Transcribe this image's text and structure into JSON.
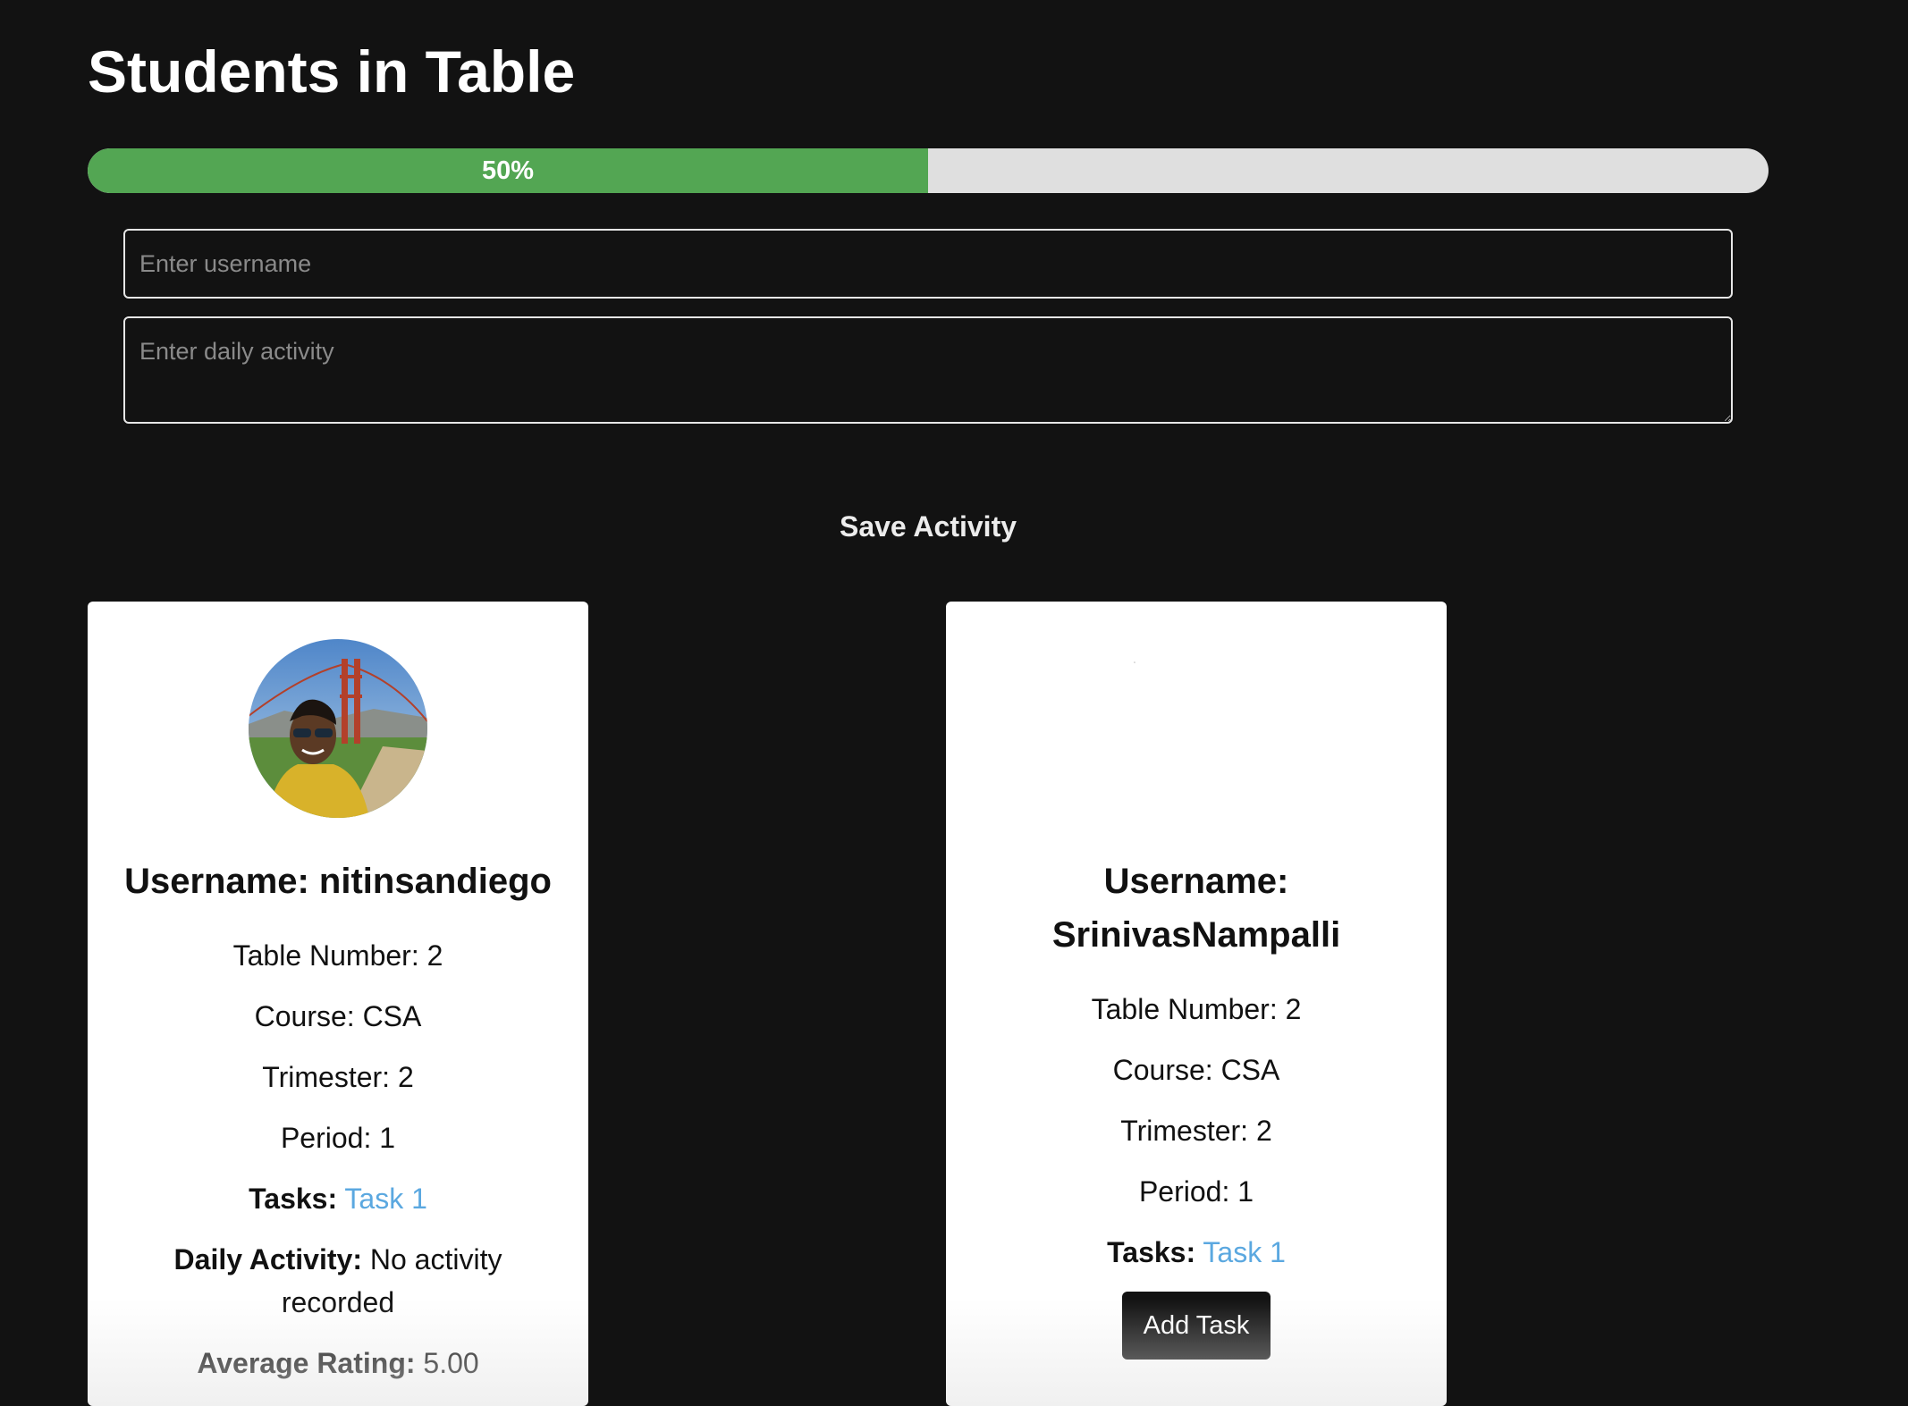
{
  "page": {
    "title": "Students in Table"
  },
  "progress": {
    "percent": 50,
    "label": "50%"
  },
  "form": {
    "username_placeholder": "Enter username",
    "username_value": "",
    "activity_placeholder": "Enter daily activity",
    "activity_value": "",
    "save_label": "Save Activity"
  },
  "cards": [
    {
      "username_line1": "Username: nitinsandiego",
      "username_line2": "",
      "has_photo": true,
      "table_number": "Table Number: 2",
      "course": "Course: CSA",
      "trimester": "Trimester: 2",
      "period": "Period: 1",
      "tasks_label": "Tasks:",
      "task_link": "Task 1",
      "daily_activity_label": "Daily Activity:",
      "daily_activity_value": "No activity recorded",
      "average_rating_label": "Average Rating:",
      "average_rating_value": "5.00"
    },
    {
      "username_line1": "Username:",
      "username_line2": "SrinivasNampalli",
      "has_photo": false,
      "table_number": "Table Number: 2",
      "course": "Course: CSA",
      "trimester": "Trimester: 2",
      "period": "Period: 1",
      "tasks_label": "Tasks:",
      "task_link": "Task 1",
      "add_task_label": "Add Task"
    }
  ],
  "colors": {
    "background": "#121212",
    "progress_fill": "#53a653",
    "progress_track": "#dfdfdf",
    "link": "#5ba8e0",
    "card": "#ffffff"
  }
}
